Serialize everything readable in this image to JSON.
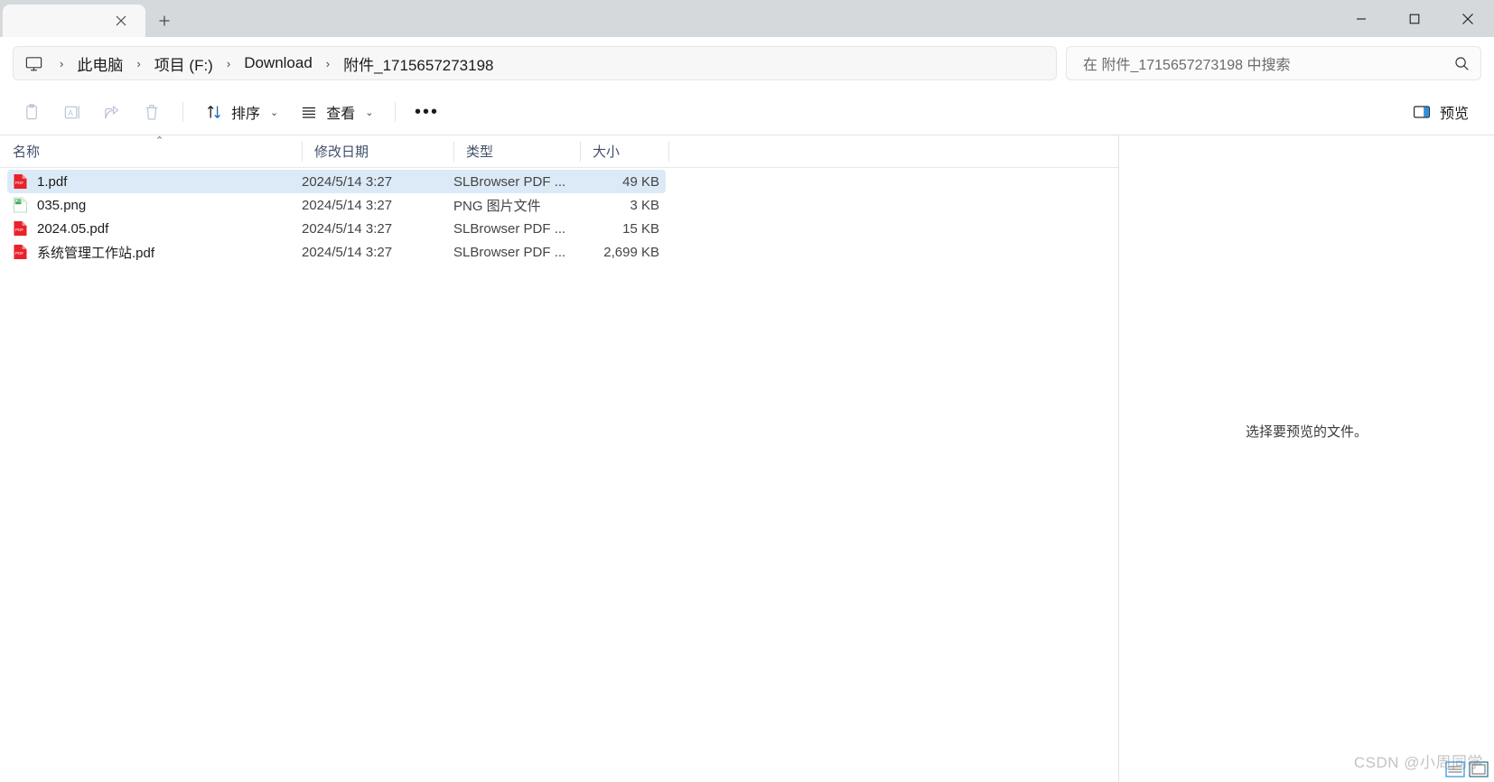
{
  "titlebar": {
    "tab_close_label": "✕",
    "new_tab_label": "+",
    "minimize_label": "minimize",
    "maximize_label": "maximize",
    "close_label": "close"
  },
  "address": {
    "pc_icon": "monitor-icon",
    "breadcrumbs": [
      {
        "label": "此电脑"
      },
      {
        "label": "项目 (F:)"
      },
      {
        "label": "Download"
      },
      {
        "label": "附件_1715657273198"
      }
    ],
    "separator": "›"
  },
  "search": {
    "placeholder": "在 附件_1715657273198 中搜索",
    "value": "",
    "icon": "search-icon"
  },
  "toolbar": {
    "icons": [
      {
        "name": "paste-icon",
        "disabled": true
      },
      {
        "name": "rename-icon",
        "disabled": true
      },
      {
        "name": "share-icon",
        "disabled": true
      },
      {
        "name": "delete-icon",
        "disabled": true
      }
    ],
    "sort_label": "排序",
    "view_label": "查看",
    "more_label": "•••",
    "caret": "⌄",
    "preview_label": "预览"
  },
  "columns": {
    "name": "名称",
    "date": "修改日期",
    "type": "类型",
    "size": "大小",
    "sort_indicator": "⌃"
  },
  "files": [
    {
      "name": "1.pdf",
      "date": "2024/5/14 3:27",
      "type": "SLBrowser PDF ...",
      "size": "49 KB",
      "icon": "pdf-file-icon",
      "selected": true
    },
    {
      "name": "035.png",
      "date": "2024/5/14 3:27",
      "type": "PNG 图片文件",
      "size": "3 KB",
      "icon": "png-file-icon",
      "selected": false
    },
    {
      "name": "2024.05.pdf",
      "date": "2024/5/14 3:27",
      "type": "SLBrowser PDF ...",
      "size": "15 KB",
      "icon": "pdf-file-icon",
      "selected": false
    },
    {
      "name": "系统管理工作站.pdf",
      "date": "2024/5/14 3:27",
      "type": "SLBrowser PDF ...",
      "size": "2,699 KB",
      "icon": "pdf-file-icon",
      "selected": false
    }
  ],
  "preview": {
    "empty_message": "选择要预览的文件。"
  },
  "watermark": {
    "text": "CSDN @小周同学"
  },
  "colors": {
    "selection": "#dceaf7",
    "accent": "#0078d4",
    "pdf_red": "#e8222a",
    "png_green": "#72c584",
    "titlebar": "#d6d9dc"
  }
}
